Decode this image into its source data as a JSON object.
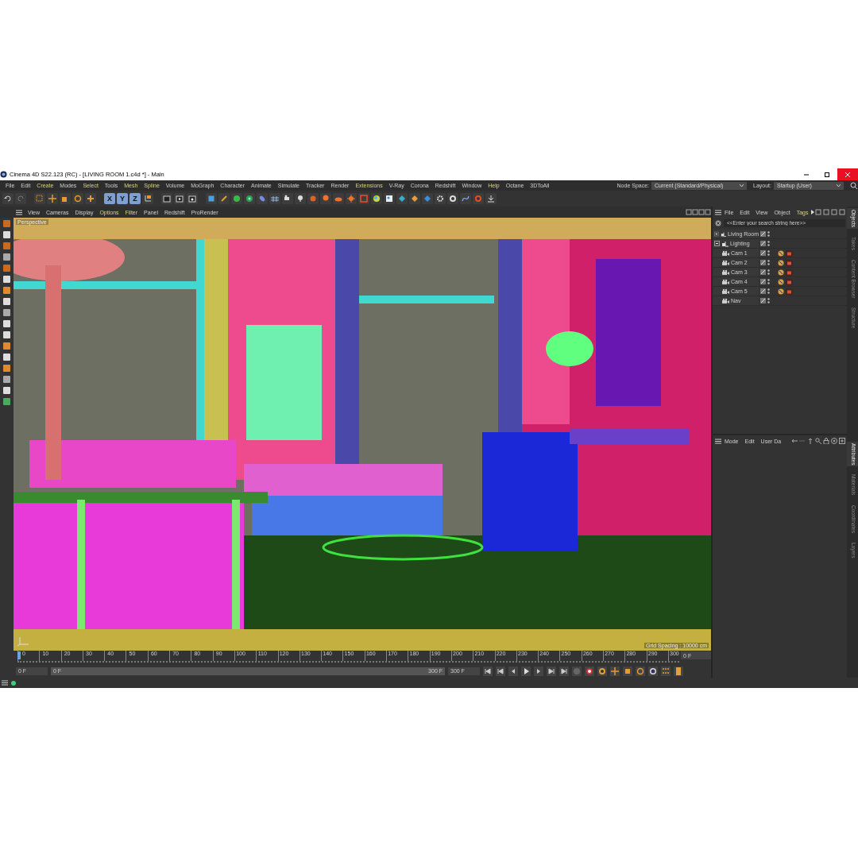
{
  "window": {
    "title": "Cinema 4D S22.123 (RC) - [LIVING ROOM 1.c4d *] - Main"
  },
  "menu_bar": [
    {
      "label": "File",
      "highlighted": false
    },
    {
      "label": "Edit",
      "highlighted": false
    },
    {
      "label": "Create",
      "highlighted": true
    },
    {
      "label": "Modes",
      "highlighted": false
    },
    {
      "label": "Select",
      "highlighted": true
    },
    {
      "label": "Tools",
      "highlighted": false
    },
    {
      "label": "Mesh",
      "highlighted": true
    },
    {
      "label": "Spline",
      "highlighted": true
    },
    {
      "label": "Volume",
      "highlighted": false
    },
    {
      "label": "MoGraph",
      "highlighted": false
    },
    {
      "label": "Character",
      "highlighted": false
    },
    {
      "label": "Animate",
      "highlighted": false
    },
    {
      "label": "Simulate",
      "highlighted": false
    },
    {
      "label": "Tracker",
      "highlighted": false
    },
    {
      "label": "Render",
      "highlighted": false
    },
    {
      "label": "Extensions",
      "highlighted": true
    },
    {
      "label": "V-Ray",
      "highlighted": false
    },
    {
      "label": "Corona",
      "highlighted": false
    },
    {
      "label": "Redshift",
      "highlighted": false
    },
    {
      "label": "Window",
      "highlighted": false
    },
    {
      "label": "Help",
      "highlighted": true
    },
    {
      "label": "Octane",
      "highlighted": false
    },
    {
      "label": "3DToAll",
      "highlighted": false
    }
  ],
  "node_space": {
    "label": "Node Space:",
    "value": "Current (Standard/Physical)"
  },
  "layout": {
    "label": "Layout:",
    "value": "Startup (User)"
  },
  "axis_buttons": [
    {
      "label": "X",
      "selected": true
    },
    {
      "label": "Y",
      "selected": true
    },
    {
      "label": "Z",
      "selected": true
    }
  ],
  "viewport": {
    "menu": [
      {
        "label": "View",
        "highlighted": false
      },
      {
        "label": "Cameras",
        "highlighted": false
      },
      {
        "label": "Display",
        "highlighted": false
      },
      {
        "label": "Options",
        "highlighted": true
      },
      {
        "label": "Filter",
        "highlighted": true
      },
      {
        "label": "Panel",
        "highlighted": false
      },
      {
        "label": "Redshift",
        "highlighted": false
      },
      {
        "label": "ProRender",
        "highlighted": false
      }
    ],
    "camera_label": "Perspective",
    "grid_spacing": "Grid Spacing : 10000 cm"
  },
  "timeline": {
    "ticks": [
      "0",
      "10",
      "20",
      "30",
      "40",
      "50",
      "60",
      "70",
      "80",
      "90",
      "100",
      "110",
      "120",
      "130",
      "140",
      "150",
      "160",
      "170",
      "180",
      "190",
      "200",
      "210",
      "220",
      "230",
      "240",
      "250",
      "260",
      "270",
      "280",
      "290",
      "300"
    ],
    "current_frame": "0 F",
    "start_field": "0 F",
    "range_bar": {
      "level": 1
    },
    "range_start": "0 F",
    "range_end": "300 F",
    "end_field": "300 F"
  },
  "objects": {
    "menu": [
      {
        "label": "File",
        "highlighted": false
      },
      {
        "label": "Edit",
        "highlighted": false
      },
      {
        "label": "View",
        "highlighted": false
      },
      {
        "label": "Object",
        "highlighted": false
      },
      {
        "label": "Tags",
        "highlighted": true
      }
    ],
    "search": {
      "placeholder": "<<Enter your search string here>>"
    },
    "tree": [
      {
        "name": "Living Room",
        "kind": "null",
        "expanded": false,
        "tagged": false
      },
      {
        "name": "Lighting",
        "kind": "null",
        "expanded": true,
        "tagged": false,
        "children": [
          {
            "name": "Cam 1",
            "kind": "camera",
            "tagged": true
          },
          {
            "name": "Cam 2",
            "kind": "camera",
            "tagged": true
          },
          {
            "name": "Cam 3",
            "kind": "camera",
            "tagged": true
          },
          {
            "name": "Cam 4",
            "kind": "camera",
            "tagged": true
          },
          {
            "name": "Cam 5",
            "kind": "camera",
            "tagged": true
          },
          {
            "name": "Nav",
            "kind": "camera",
            "tagged": false
          }
        ]
      }
    ],
    "side_tabs": [
      {
        "label": "Objects",
        "selected": true
      },
      {
        "label": "Takes",
        "selected": false
      },
      {
        "label": "Content Browser",
        "selected": false
      },
      {
        "label": "Structure",
        "selected": false
      }
    ]
  },
  "attributes": {
    "menu": [
      {
        "label": "Mode",
        "highlighted": false
      },
      {
        "label": "Edit",
        "highlighted": false
      },
      {
        "label": "User Da",
        "highlighted": false
      }
    ],
    "side_tabs": [
      {
        "label": "Attributes",
        "selected": true
      },
      {
        "label": "Materials",
        "selected": false
      },
      {
        "label": "Coordinates",
        "selected": false
      },
      {
        "label": "Layers",
        "selected": false
      }
    ]
  }
}
